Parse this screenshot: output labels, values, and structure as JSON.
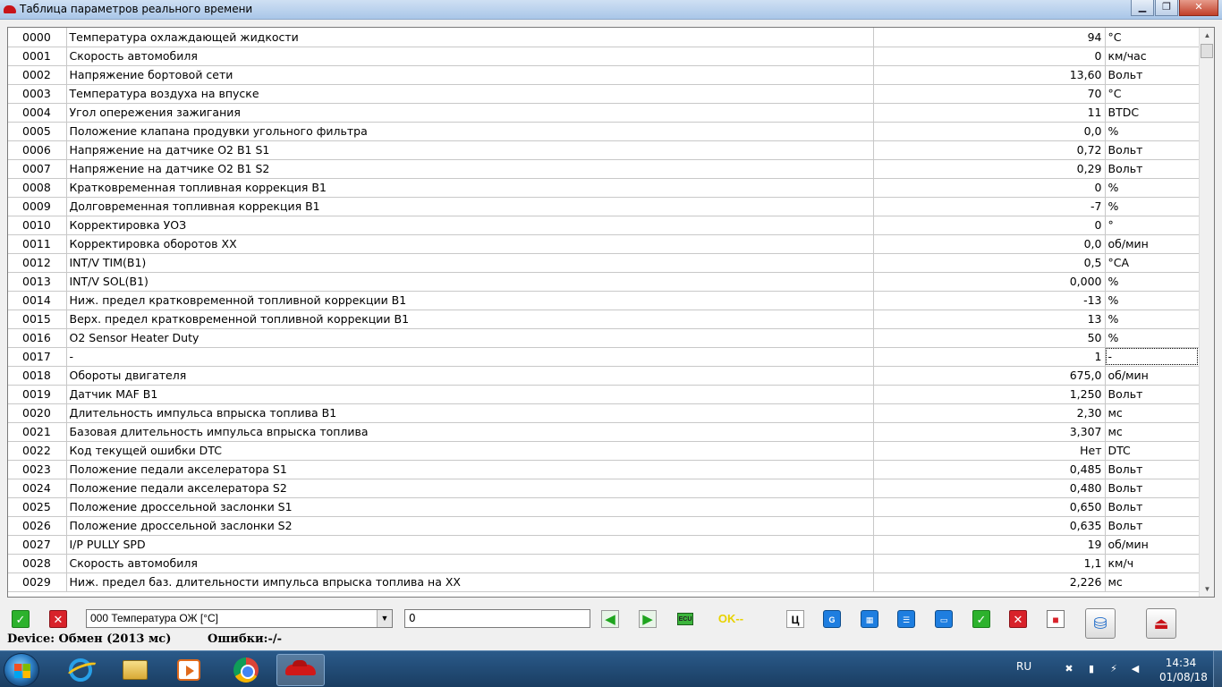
{
  "window": {
    "title": "Таблица параметров реального времени",
    "btn_min": "▁",
    "btn_max": "❐",
    "btn_close": "✕"
  },
  "table": {
    "selected_row": 17,
    "rows": [
      {
        "id": "0000",
        "name": "Температура охлаждающей жидкости",
        "value": "94",
        "unit": "°C"
      },
      {
        "id": "0001",
        "name": "Скорость автомобиля",
        "value": "0",
        "unit": "км/час"
      },
      {
        "id": "0002",
        "name": "Напряжение бортовой сети",
        "value": "13,60",
        "unit": "Вольт"
      },
      {
        "id": "0003",
        "name": "Температура воздуха на впуске",
        "value": "70",
        "unit": "°C"
      },
      {
        "id": "0004",
        "name": "Угол опережения зажигания",
        "value": "11",
        "unit": "BTDC"
      },
      {
        "id": "0005",
        "name": "Положение клапана продувки угольного фильтра",
        "value": "0,0",
        "unit": "%"
      },
      {
        "id": "0006",
        "name": "Напряжение на датчике O2 B1 S1",
        "value": "0,72",
        "unit": "Вольт"
      },
      {
        "id": "0007",
        "name": "Напряжение на датчике O2 B1 S2",
        "value": "0,29",
        "unit": "Вольт"
      },
      {
        "id": "0008",
        "name": "Кратковременная топливная коррекция B1",
        "value": "0",
        "unit": "%"
      },
      {
        "id": "0009",
        "name": "Долговременная топливная коррекция B1",
        "value": "-7",
        "unit": "%"
      },
      {
        "id": "0010",
        "name": "Корректировка УОЗ",
        "value": "0",
        "unit": "°"
      },
      {
        "id": "0011",
        "name": "Корректировка оборотов ХХ",
        "value": "0,0",
        "unit": "об/мин"
      },
      {
        "id": "0012",
        "name": "INT/V TIM(B1)",
        "value": "0,5",
        "unit": "°CA"
      },
      {
        "id": "0013",
        "name": "INT/V SOL(B1)",
        "value": "0,000",
        "unit": "%"
      },
      {
        "id": "0014",
        "name": "Ниж. предел кратковременной топливной коррекции B1",
        "value": "-13",
        "unit": "%"
      },
      {
        "id": "0015",
        "name": "Верх. предел кратковременной топливной коррекции B1",
        "value": "13",
        "unit": "%"
      },
      {
        "id": "0016",
        "name": "O2 Sensor Heater Duty",
        "value": "50",
        "unit": "%"
      },
      {
        "id": "0017",
        "name": "-",
        "value": "1",
        "unit": "-"
      },
      {
        "id": "0018",
        "name": "Обороты двигателя",
        "value": "675,0",
        "unit": "об/мин"
      },
      {
        "id": "0019",
        "name": "Датчик MAF B1",
        "value": "1,250",
        "unit": "Вольт"
      },
      {
        "id": "0020",
        "name": "Длительность импульса впрыска топлива B1",
        "value": "2,30",
        "unit": "мс"
      },
      {
        "id": "0021",
        "name": "Базовая длительность импульса впрыска топлива",
        "value": "3,307",
        "unit": "мс"
      },
      {
        "id": "0022",
        "name": "Код текущей ошибки DTC",
        "value": "Нет",
        "unit": "DTC"
      },
      {
        "id": "0023",
        "name": "Положение педали акселератора S1",
        "value": "0,485",
        "unit": "Вольт"
      },
      {
        "id": "0024",
        "name": "Положение педали акселератора S2",
        "value": "0,480",
        "unit": "Вольт"
      },
      {
        "id": "0025",
        "name": "Положение дроссельной заслонки S1",
        "value": "0,650",
        "unit": "Вольт"
      },
      {
        "id": "0026",
        "name": "Положение дроссельной заслонки S2",
        "value": "0,635",
        "unit": "Вольт"
      },
      {
        "id": "0027",
        "name": "I/P PULLY SPD",
        "value": "19",
        "unit": "об/мин"
      },
      {
        "id": "0028",
        "name": "Скорость автомобиля",
        "value": "1,1",
        "unit": "км/ч"
      },
      {
        "id": "0029",
        "name": "Ниж. предел баз. длительности импульса впрыска топлива на ХХ",
        "value": "2,226",
        "unit": "мс"
      }
    ]
  },
  "toolbar": {
    "ok_icon": "✓",
    "cancel_icon": "✕",
    "param_select": "000 Температура ОЖ [°C]",
    "value_input": "0",
    "left_icon": "◀",
    "right_icon": "▶",
    "ecu_label": "ECU",
    "ok_label": "OK--",
    "ts_label": "Ц",
    "g_label": "G",
    "stop_icon": "■"
  },
  "status": {
    "device": "Device: Обмен (2013 мс)",
    "errors": "Ошибки:-/-"
  },
  "taskbar": {
    "lang": "RU",
    "time": "14:34",
    "date": "01/08/18"
  },
  "colors": {
    "accent": "#2db22d",
    "danger": "#d8222a",
    "taskbar": "#1a3d62"
  }
}
